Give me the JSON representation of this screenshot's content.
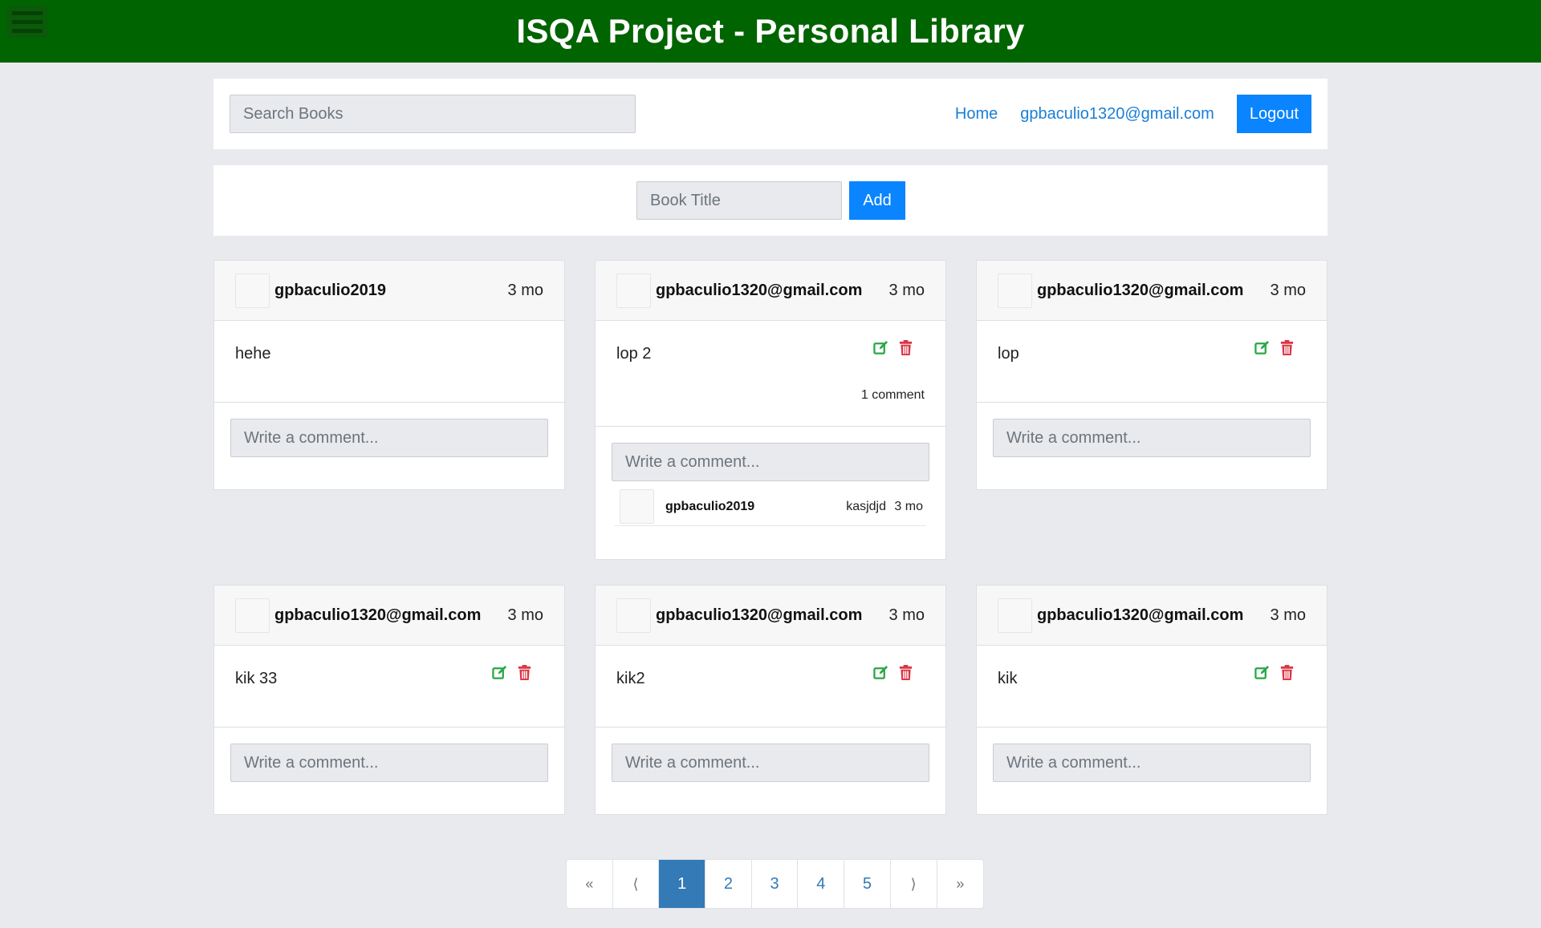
{
  "header": {
    "title": "ISQA Project - Personal Library"
  },
  "nav": {
    "search_placeholder": "Search Books",
    "home_label": "Home",
    "user_label": "gpbaculio1320@gmail.com",
    "logout_label": "Logout"
  },
  "add_form": {
    "title_placeholder": "Book Title",
    "add_label": "Add"
  },
  "comment_placeholder": "Write a comment...",
  "books": [
    {
      "author": "gpbaculio2019",
      "time": "3 mo",
      "title": "hehe"
    },
    {
      "author": "gpbaculio1320@gmail.com",
      "time": "3 mo",
      "title": "lop 2",
      "comment_count": "1 comment",
      "comments": [
        {
          "author": "gpbaculio2019",
          "text": "kasjdjd",
          "time": "3 mo"
        }
      ]
    },
    {
      "author": "gpbaculio1320@gmail.com",
      "time": "3 mo",
      "title": "lop"
    },
    {
      "author": "gpbaculio1320@gmail.com",
      "time": "3 mo",
      "title": "kik 33"
    },
    {
      "author": "gpbaculio1320@gmail.com",
      "time": "3 mo",
      "title": "kik2"
    },
    {
      "author": "gpbaculio1320@gmail.com",
      "time": "3 mo",
      "title": "kik"
    }
  ],
  "pagination": {
    "first": "«",
    "prev": "⟨",
    "pages": [
      "1",
      "2",
      "3",
      "4",
      "5"
    ],
    "next": "⟩",
    "last": "»",
    "current": "1"
  },
  "colors": {
    "header": "#006400",
    "primary": "#0a84ff",
    "edit_icon": "#28a745",
    "delete_icon": "#dc3545",
    "page_active": "#337ab7"
  },
  "icons": {
    "edit": "edit-icon",
    "delete": "trash-icon",
    "menu": "menu-icon"
  }
}
